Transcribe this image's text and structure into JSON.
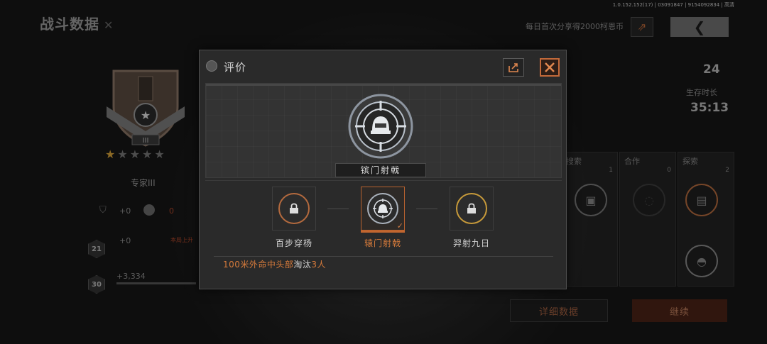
{
  "header": {
    "title": "战斗数据",
    "version": "1.0.152.152(17) | 03091847 | 9154092834 | 高清",
    "share_note": "每日首次分享得2000柯恩币"
  },
  "left_panel": {
    "rank_tier": "III",
    "rank_name": "专家III",
    "stars_filled": 1,
    "stars_total": 5,
    "stat_a": "+0",
    "stat_b": "0",
    "level_badge_1": "21",
    "level_value_1": "+0",
    "level_hint": "本局上升",
    "level_badge_2": "30",
    "level_value_2": "+3,334"
  },
  "right_panel": {
    "kills_value": "24",
    "survival_label": "生存时长",
    "survival_value": "35:13",
    "categories": [
      {
        "name": "搜索",
        "count": "1"
      },
      {
        "name": "合作",
        "count": "0"
      },
      {
        "name": "探索",
        "count": "2"
      }
    ]
  },
  "bottom": {
    "details_label": "详细数据",
    "continue_label": "继续"
  },
  "dialog": {
    "title": "评价",
    "featured_badge": "镔门射戟",
    "options": [
      {
        "label": "百步穿杨",
        "locked": true,
        "ring_color": "#b46a3e"
      },
      {
        "label": "辕门射戟",
        "locked": false,
        "ring_color": "#aab2bc"
      },
      {
        "label": "羿射九日",
        "locked": true,
        "ring_color": "#c79a3a"
      }
    ],
    "desc_highlight": "100米外命中头部",
    "desc_rest": "淘汰",
    "desc_count": "3人"
  },
  "colors": {
    "accent": "#c2662f",
    "highlight_text": "#d77b3b"
  }
}
